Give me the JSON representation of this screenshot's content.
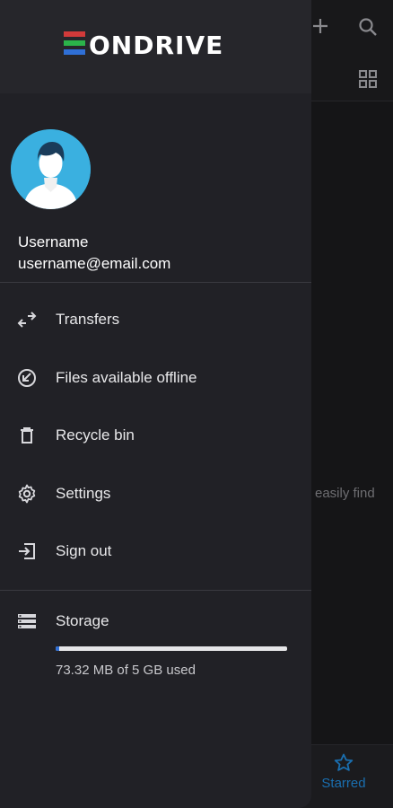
{
  "background": {
    "hint_text": "easily find",
    "bottom_tab_label": "Starred"
  },
  "drawer": {
    "logo_text": "EONDRIVE",
    "user": {
      "name": "Username",
      "email": "username@email.com"
    },
    "menu": [
      {
        "label": "Transfers",
        "icon": "transfers-icon"
      },
      {
        "label": "Files available offline",
        "icon": "offline-icon"
      },
      {
        "label": "Recycle bin",
        "icon": "trash-icon"
      },
      {
        "label": "Settings",
        "icon": "gear-icon"
      },
      {
        "label": "Sign out",
        "icon": "sign-out-icon"
      }
    ],
    "storage": {
      "label": "Storage",
      "used_text": "73.32 MB of 5 GB used",
      "used_fraction": 0.014
    }
  },
  "colors": {
    "accent": "#2f6fd6",
    "avatar_bg": "#3ab0e0",
    "drawer_bg": "#212126",
    "starred_tab": "#1a6fb0"
  }
}
